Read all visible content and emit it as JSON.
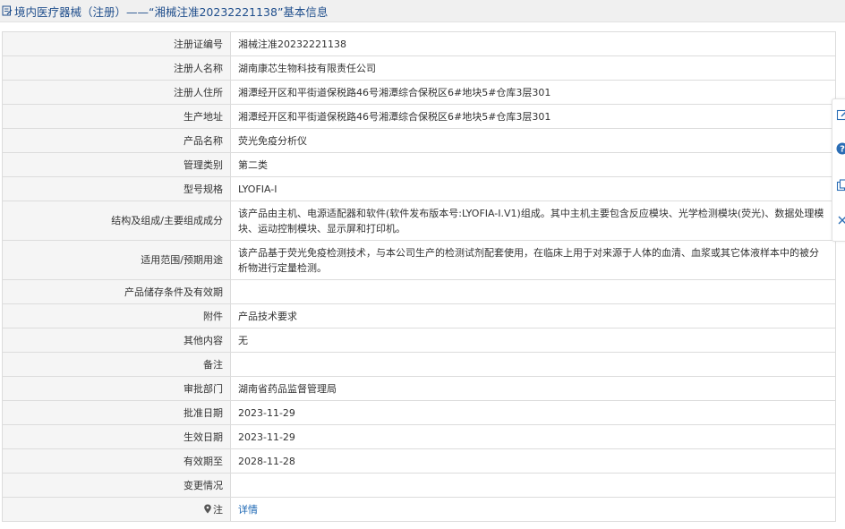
{
  "header": {
    "icon": "document-edit-icon",
    "title": "境内医疗器械（注册）——“湘械注准20232221138”基本信息"
  },
  "rows": [
    {
      "label": "注册证编号",
      "value": "湘械注准20232221138"
    },
    {
      "label": "注册人名称",
      "value": "湖南康芯生物科技有限责任公司"
    },
    {
      "label": "注册人住所",
      "value": "湘潭经开区和平街道保税路46号湘潭综合保税区6#地块5#仓库3层301"
    },
    {
      "label": "生产地址",
      "value": "湘潭经开区和平街道保税路46号湘潭综合保税区6#地块5#仓库3层301"
    },
    {
      "label": "产品名称",
      "value": "荧光免疫分析仪"
    },
    {
      "label": "管理类别",
      "value": "第二类"
    },
    {
      "label": "型号规格",
      "value": "LYOFIA-I"
    },
    {
      "label": "结构及组成/主要组成成分",
      "value": "该产品由主机、电源适配器和软件(软件发布版本号:LYOFIA-Ⅰ.V1)组成。其中主机主要包含反应模块、光学检测模块(荧光)、数据处理模块、运动控制模块、显示屏和打印机。"
    },
    {
      "label": "适用范围/预期用途",
      "value": "该产品基于荧光免疫检测技术，与本公司生产的检测试剂配套使用，在临床上用于对来源于人体的血清、血浆或其它体液样本中的被分析物进行定量检测。"
    },
    {
      "label": "产品储存条件及有效期",
      "value": ""
    },
    {
      "label": "附件",
      "value": "产品技术要求"
    },
    {
      "label": "其他内容",
      "value": "无"
    },
    {
      "label": "备注",
      "value": ""
    },
    {
      "label": "审批部门",
      "value": "湖南省药品监督管理局"
    },
    {
      "label": "批准日期",
      "value": "2023-11-29"
    },
    {
      "label": "生效日期",
      "value": "2023-11-29"
    },
    {
      "label": "有效期至",
      "value": "2028-11-28"
    },
    {
      "label": "变更情况",
      "value": ""
    },
    {
      "label": "注",
      "value": "详情",
      "icon": "pin-icon"
    }
  ],
  "float_toolbar": {
    "icons": [
      "edit-icon",
      "help-icon",
      "copy-icon",
      "close-icon"
    ]
  },
  "colors": {
    "title_text": "#1f4e8c",
    "link": "#1a66b3",
    "label_bg": "#f5f5f5",
    "help_icon": "#2a6db5"
  }
}
